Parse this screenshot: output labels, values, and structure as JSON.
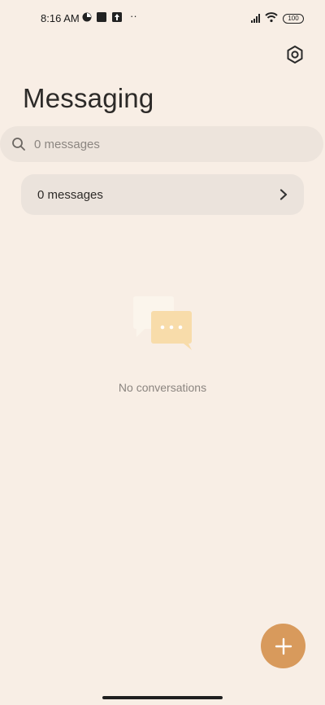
{
  "status_bar": {
    "time": "8:16 AM",
    "battery": "100",
    "more": "··"
  },
  "header": {
    "title": "Messaging",
    "settings_icon": "settings-hex-icon"
  },
  "search": {
    "placeholder": "0 messages",
    "icon": "search-icon"
  },
  "messages_card": {
    "label": "0 messages",
    "icon": "chevron-right-icon"
  },
  "empty_state": {
    "text": "No conversations",
    "icon": "chat-bubbles-icon"
  },
  "fab": {
    "icon": "plus-icon"
  },
  "colors": {
    "background": "#f8eee5",
    "accent": "#d89a5c",
    "card": "#ebe3dc"
  }
}
